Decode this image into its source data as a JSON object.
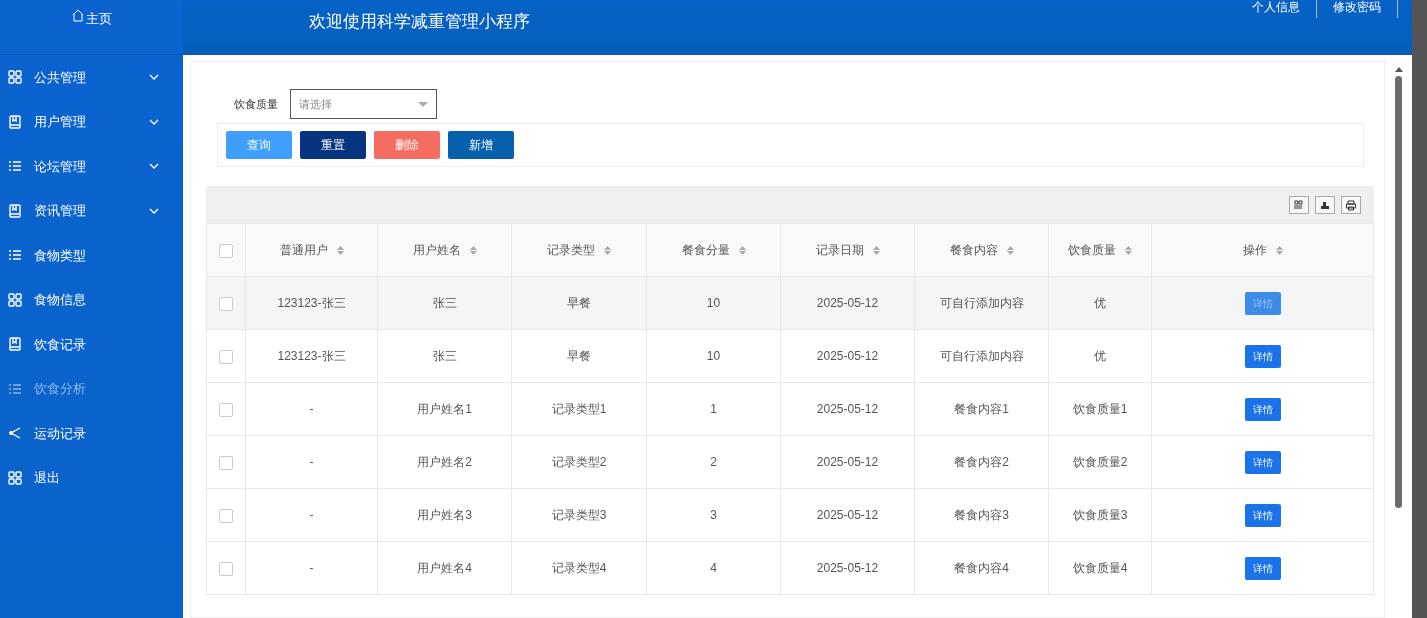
{
  "sidebar": {
    "home": "主页",
    "items": [
      {
        "label": "公共管理",
        "kind": "grid",
        "submenu": true,
        "selected": false
      },
      {
        "label": "用户管理",
        "kind": "book",
        "submenu": true,
        "selected": false
      },
      {
        "label": "论坛管理",
        "kind": "list",
        "submenu": true,
        "selected": false
      },
      {
        "label": "资讯管理",
        "kind": "book",
        "submenu": true,
        "selected": false
      },
      {
        "label": "食物类型",
        "kind": "list",
        "submenu": false,
        "selected": false
      },
      {
        "label": "食物信息",
        "kind": "grid",
        "submenu": false,
        "selected": false
      },
      {
        "label": "饮食记录",
        "kind": "book",
        "submenu": false,
        "selected": false
      },
      {
        "label": "饮食分析",
        "kind": "list",
        "submenu": false,
        "selected": true
      },
      {
        "label": "运动记录",
        "kind": "share",
        "submenu": false,
        "selected": false
      },
      {
        "label": "退出",
        "kind": "grid",
        "submenu": false,
        "selected": false
      }
    ]
  },
  "header": {
    "title": "欢迎使用科学减重管理小程序",
    "links": [
      "个人信息",
      "修改密码"
    ]
  },
  "filter": {
    "label": "饮食质量",
    "placeholder": "请选择"
  },
  "buttons": [
    {
      "label": "查询",
      "kind": "search"
    },
    {
      "label": "重置",
      "kind": "reset"
    },
    {
      "label": "删除",
      "kind": "delete"
    },
    {
      "label": "新增",
      "kind": "add"
    }
  ],
  "table": {
    "select_all_checked": false,
    "columns": [
      "普通用户",
      "用户姓名",
      "记录类型",
      "餐食分量",
      "记录日期",
      "餐食内容",
      "饮食质量",
      "操作"
    ],
    "rows": [
      {
        "cells": [
          "123123-张三",
          "张三",
          "早餐",
          "10",
          "2025-05-12",
          "可自行添加内容",
          "优"
        ],
        "action": "详情",
        "hovered": true,
        "checked": false
      },
      {
        "cells": [
          "123123-张三",
          "张三",
          "早餐",
          "10",
          "2025-05-12",
          "可自行添加内容",
          "优"
        ],
        "action": "详情",
        "hovered": false,
        "checked": false
      },
      {
        "cells": [
          "-",
          "用户姓名1",
          "记录类型1",
          "1",
          "2025-05-12",
          "餐食内容1",
          "饮食质量1"
        ],
        "action": "详情",
        "hovered": false,
        "checked": false
      },
      {
        "cells": [
          "-",
          "用户姓名2",
          "记录类型2",
          "2",
          "2025-05-12",
          "餐食内容2",
          "饮食质量2"
        ],
        "action": "详情",
        "hovered": false,
        "checked": false
      },
      {
        "cells": [
          "-",
          "用户姓名3",
          "记录类型3",
          "3",
          "2025-05-12",
          "餐食内容3",
          "饮食质量3"
        ],
        "action": "详情",
        "hovered": false,
        "checked": false
      },
      {
        "cells": [
          "-",
          "用户姓名4",
          "记录类型4",
          "4",
          "2025-05-12",
          "餐食内容4",
          "饮食质量4"
        ],
        "action": "详情",
        "hovered": false,
        "checked": false
      }
    ]
  }
}
